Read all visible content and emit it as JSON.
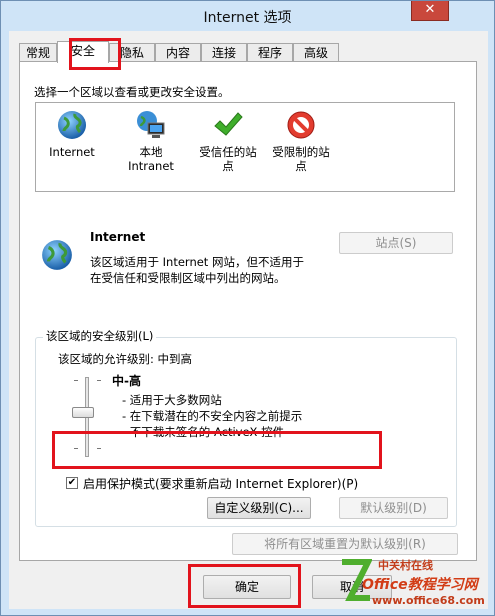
{
  "window": {
    "title": "Internet 选项",
    "close_glyph": "✕"
  },
  "tabs": [
    {
      "label": "常规"
    },
    {
      "label": "安全"
    },
    {
      "label": "隐私"
    },
    {
      "label": "内容"
    },
    {
      "label": "连接"
    },
    {
      "label": "程序"
    },
    {
      "label": "高级"
    }
  ],
  "active_tab": "安全",
  "security": {
    "instruction": "选择一个区域以查看或更改安全设置。",
    "zones": [
      {
        "label": "Internet",
        "icon": "globe-icon"
      },
      {
        "label": "本地\nIntranet",
        "icon": "intranet-icon"
      },
      {
        "label": "受信任的站\n点",
        "icon": "trusted-check-icon"
      },
      {
        "label": "受限制的站\n点",
        "icon": "restricted-icon"
      }
    ],
    "selected_zone": {
      "name": "Internet",
      "desc_line1": "该区域适用于 Internet 网站，但不适用于",
      "desc_line2": "在受信任和受限制区域中列出的网站。"
    },
    "sites_button": "站点(S)",
    "level_group_label": "该区域的安全级别(L)",
    "allowed_levels": "该区域的允许级别: 中到高",
    "current_level": "中-高",
    "bullets": [
      "- 适用于大多数网站",
      "- 在下载潜在的不安全内容之前提示",
      "- 不下载未签名的 ActiveX 控件"
    ],
    "protected_mode": {
      "label": "启用保护模式(要求重新启动 Internet Explorer)(P)",
      "checked": true,
      "check_glyph": "✔"
    },
    "custom_level_button": "自定义级别(C)...",
    "default_level_button": "默认级别(D)",
    "reset_all_button": "将所有区域重置为默认级别(R)"
  },
  "footer": {
    "ok": "确定",
    "cancel": "取消"
  },
  "watermark": {
    "line1": "中关村在线",
    "line2": "Office教程学习网",
    "line3": "www.office68.com"
  },
  "colors": {
    "highlight_box": "#e2131c",
    "window_frame": "#cfe4f7"
  }
}
